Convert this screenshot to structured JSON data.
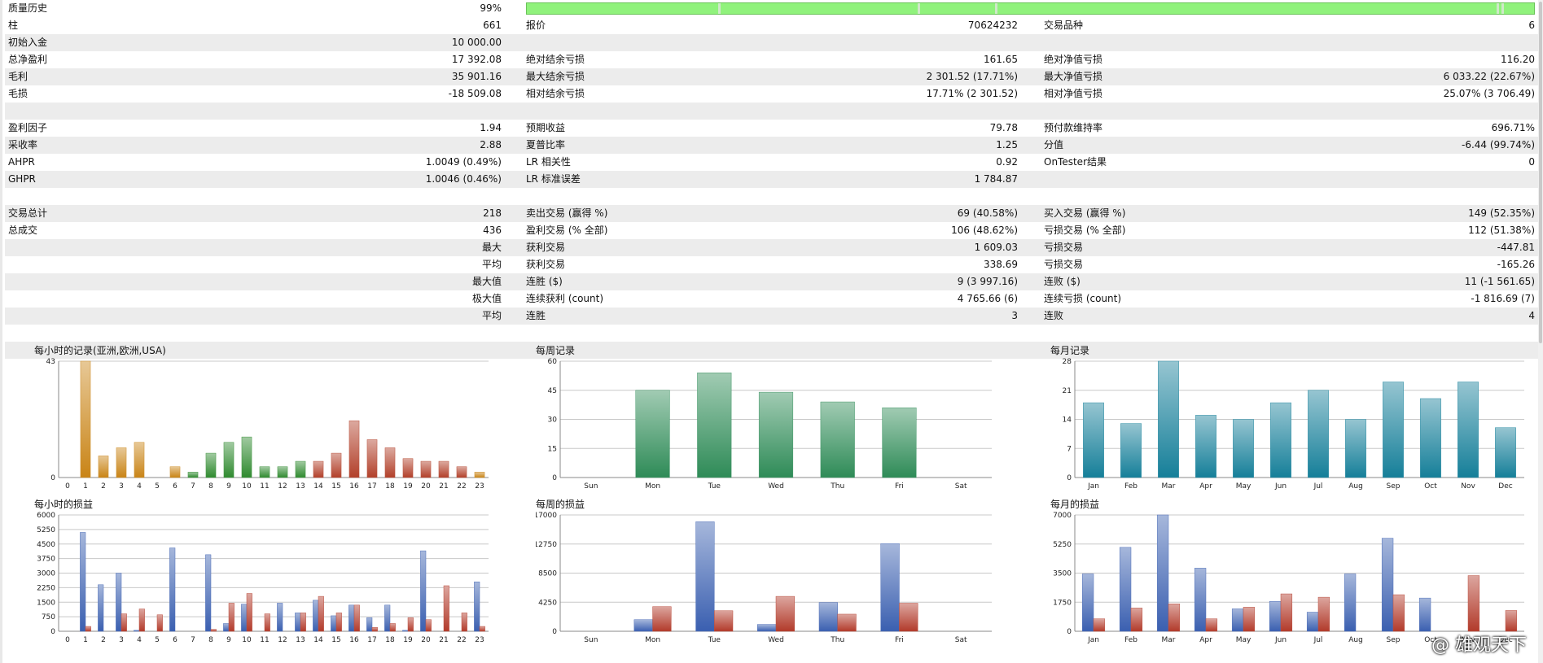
{
  "quality": {
    "label": "质量历史",
    "value": "99%",
    "gaps": [
      0.19,
      0.388,
      0.465,
      0.963,
      0.968
    ]
  },
  "report_rows": [
    {
      "shaded": false,
      "l1": "柱",
      "v1": "661",
      "l2": "报价",
      "v2": "70624232",
      "l3": "交易品种",
      "v3": "6"
    },
    {
      "shaded": true,
      "l1": "初始入金",
      "v1": "10 000.00",
      "l2": "",
      "v2": "",
      "l3": "",
      "v3": ""
    },
    {
      "shaded": false,
      "l1": "总净盈利",
      "v1": "17 392.08",
      "l2": "绝对结余亏损",
      "v2": "161.65",
      "l3": "绝对净值亏损",
      "v3": "116.20"
    },
    {
      "shaded": true,
      "l1": "毛利",
      "v1": "35 901.16",
      "l2": "最大结余亏损",
      "v2": "2 301.52 (17.71%)",
      "l3": "最大净值亏损",
      "v3": "6 033.22 (22.67%)"
    },
    {
      "shaded": false,
      "l1": "毛损",
      "v1": "-18 509.08",
      "l2": "相对结余亏损",
      "v2": "17.71% (2 301.52)",
      "l3": "相对净值亏损",
      "v3": "25.07% (3 706.49)"
    },
    {
      "shaded": true,
      "l1": "",
      "v1": "",
      "l2": "",
      "v2": "",
      "l3": "",
      "v3": ""
    },
    {
      "shaded": false,
      "l1": "盈利因子",
      "v1": "1.94",
      "l2": "预期收益",
      "v2": "79.78",
      "l3": "预付款维持率",
      "v3": "696.71%"
    },
    {
      "shaded": true,
      "l1": "采收率",
      "v1": "2.88",
      "l2": "夏普比率",
      "v2": "1.25",
      "l3": "分值",
      "v3": "-6.44 (99.74%)"
    },
    {
      "shaded": false,
      "l1": "AHPR",
      "v1": "1.0049 (0.49%)",
      "l2": "LR 相关性",
      "v2": "0.92",
      "l3": "OnTester结果",
      "v3": "0"
    },
    {
      "shaded": true,
      "l1": "GHPR",
      "v1": "1.0046 (0.46%)",
      "l2": "LR 标准误差",
      "v2": "1 784.87",
      "l3": "",
      "v3": ""
    },
    {
      "shaded": false,
      "l1": "",
      "v1": "",
      "l2": "",
      "v2": "",
      "l3": "",
      "v3": ""
    },
    {
      "shaded": true,
      "l1": "交易总计",
      "v1": "218",
      "l2": "卖出交易 (赢得 %)",
      "v2": "69 (40.58%)",
      "l3": "买入交易 (赢得 %)",
      "v3": "149 (52.35%)"
    },
    {
      "shaded": false,
      "l1": "总成交",
      "v1": "436",
      "l2": "盈利交易 (% 全部)",
      "v2": "106 (48.62%)",
      "l3": "亏损交易 (% 全部)",
      "v3": "112 (51.38%)"
    },
    {
      "shaded": true,
      "l1": "",
      "v1": "最大",
      "l2": "获利交易",
      "v2": "1 609.03",
      "l3": "亏损交易",
      "v3": "-447.81"
    },
    {
      "shaded": false,
      "l1": "",
      "v1": "平均",
      "l2": "获利交易",
      "v2": "338.69",
      "l3": "亏损交易",
      "v3": "-165.26"
    },
    {
      "shaded": true,
      "l1": "",
      "v1": "最大值",
      "l2": "连胜 ($)",
      "v2": "9 (3 997.16)",
      "l3": "连败 ($)",
      "v3": "11 (-1 561.65)"
    },
    {
      "shaded": false,
      "l1": "",
      "v1": "极大值",
      "l2": "连续获利 (count)",
      "v2": "4 765.66 (6)",
      "l3": "连续亏损 (count)",
      "v3": "-1 816.69 (7)"
    },
    {
      "shaded": true,
      "l1": "",
      "v1": "平均",
      "l2": "连胜",
      "v2": "3",
      "l3": "连败",
      "v3": "4"
    },
    {
      "shaded": false,
      "l1": "",
      "v1": "",
      "l2": "",
      "v2": "",
      "l3": "",
      "v3": ""
    },
    {
      "shaded": true,
      "l1": "",
      "v1": "",
      "l2": "",
      "v2": "",
      "l3": "",
      "v3": ""
    }
  ],
  "watermark": "@ 雄观天下",
  "chart_data": [
    {
      "type": "bar",
      "title": "每小时的记录(亚洲,欧洲,USA)",
      "categories": [
        "0",
        "1",
        "2",
        "3",
        "4",
        "5",
        "6",
        "7",
        "8",
        "9",
        "10",
        "11",
        "12",
        "13",
        "14",
        "15",
        "16",
        "17",
        "18",
        "19",
        "20",
        "21",
        "22",
        "23"
      ],
      "values": [
        0,
        43,
        8,
        11,
        13,
        0,
        4,
        2,
        9,
        13,
        15,
        4,
        4,
        6,
        6,
        9,
        21,
        14,
        11,
        7,
        6,
        6,
        4,
        2
      ],
      "colors": [
        "#c98416",
        "#c98416",
        "#c98416",
        "#c98416",
        "#c98416",
        "#c98416",
        "#c98416",
        "#2f8a2f",
        "#2f8a2f",
        "#2f8a2f",
        "#2f8a2f",
        "#2f8a2f",
        "#2f8a2f",
        "#2f8a2f",
        "#b2402a",
        "#b2402a",
        "#b2402a",
        "#b2402a",
        "#b2402a",
        "#b2402a",
        "#b2402a",
        "#b2402a",
        "#b2402a",
        "#c98416"
      ],
      "ylim": [
        0,
        43
      ],
      "yticks": [
        "0",
        "43"
      ]
    },
    {
      "type": "bar",
      "title": "每周记录",
      "categories": [
        "Sun",
        "Mon",
        "Tue",
        "Wed",
        "Thu",
        "Fri",
        "Sat"
      ],
      "values": [
        0,
        45,
        54,
        44,
        39,
        36,
        0
      ],
      "color": "#2e8b57",
      "ylim": [
        0,
        60
      ],
      "yticks": [
        "0",
        "15",
        "30",
        "45",
        "60"
      ]
    },
    {
      "type": "bar",
      "title": "每月记录",
      "categories": [
        "Jan",
        "Feb",
        "Mar",
        "Apr",
        "May",
        "Jun",
        "Jul",
        "Aug",
        "Sep",
        "Oct",
        "Nov",
        "Dec"
      ],
      "values": [
        18,
        13,
        28,
        15,
        14,
        18,
        21,
        14,
        23,
        19,
        23,
        12
      ],
      "color": "#157f99",
      "ylim": [
        0,
        28
      ],
      "yticks": [
        "0",
        "7",
        "14",
        "21",
        "28"
      ]
    },
    {
      "type": "bar",
      "title": "每小时的损益",
      "categories": [
        "0",
        "1",
        "2",
        "3",
        "4",
        "5",
        "6",
        "7",
        "8",
        "9",
        "10",
        "11",
        "12",
        "13",
        "14",
        "15",
        "16",
        "17",
        "18",
        "19",
        "20",
        "21",
        "22",
        "23"
      ],
      "series": [
        {
          "values": [
            0,
            5100,
            2400,
            3000,
            50,
            0,
            4300,
            0,
            3950,
            400,
            1400,
            0,
            1450,
            950,
            1600,
            800,
            1350,
            700,
            1350,
            50,
            4150,
            0,
            0,
            2550
          ],
          "color": "#3a5fb0"
        },
        {
          "values": [
            0,
            250,
            0,
            900,
            1150,
            850,
            0,
            0,
            100,
            1450,
            1950,
            900,
            0,
            950,
            1800,
            950,
            1350,
            200,
            400,
            700,
            600,
            2350,
            950,
            250
          ],
          "color": "#b23a2a"
        }
      ],
      "ylim": [
        0,
        6000
      ],
      "yticks": [
        "0",
        "750",
        "1500",
        "2250",
        "3000",
        "3750",
        "4500",
        "5250",
        "6000"
      ]
    },
    {
      "type": "bar",
      "title": "每周的损益",
      "categories": [
        "Sun",
        "Mon",
        "Tue",
        "Wed",
        "Thu",
        "Fri",
        "Sat"
      ],
      "series": [
        {
          "values": [
            0,
            1700,
            16000,
            1000,
            4200,
            12800,
            0
          ],
          "color": "#3a5fb0"
        },
        {
          "values": [
            0,
            3600,
            3000,
            5100,
            2500,
            4100,
            0
          ],
          "color": "#b23a2a"
        }
      ],
      "ylim": [
        0,
        17000
      ],
      "yticks": [
        "0",
        "4250",
        "8500",
        "12750",
        "17000"
      ]
    },
    {
      "type": "bar",
      "title": "每月的损益",
      "categories": [
        "Jan",
        "Feb",
        "Mar",
        "Apr",
        "May",
        "Jun",
        "Jul",
        "Aug",
        "Sep",
        "Oct",
        "Nov",
        "Dec"
      ],
      "series": [
        {
          "values": [
            3450,
            5050,
            7000,
            3800,
            1350,
            1800,
            1150,
            3450,
            5600,
            2000,
            0,
            0
          ],
          "color": "#3a5fb0"
        },
        {
          "values": [
            750,
            1400,
            1650,
            750,
            1450,
            2250,
            2050,
            0,
            2200,
            0,
            3350,
            1250
          ],
          "color": "#b23a2a"
        }
      ],
      "ylim": [
        0,
        7000
      ],
      "yticks": [
        "0",
        "1750",
        "3500",
        "5250",
        "7000"
      ]
    }
  ]
}
